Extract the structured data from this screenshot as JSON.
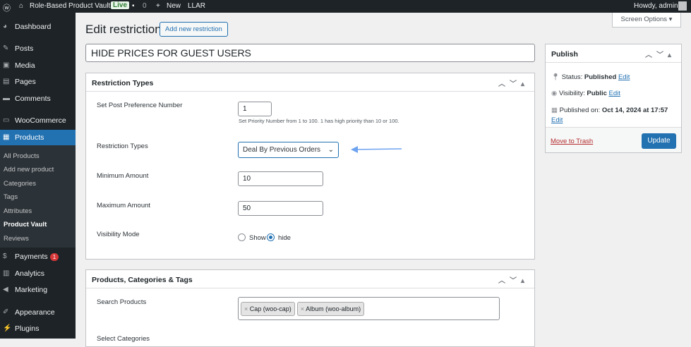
{
  "adminbar": {
    "site": "Role-Based Product Vault",
    "live": "Live",
    "comments": "0",
    "new": "New",
    "llar": "LLAR",
    "howdy": "Howdy, admin"
  },
  "sidebar": {
    "items": [
      "Dashboard",
      "Posts",
      "Media",
      "Pages",
      "Comments",
      "WooCommerce",
      "Products",
      "Payments",
      "Analytics",
      "Marketing",
      "Appearance",
      "Plugins"
    ],
    "payments_badge": "1",
    "sub": [
      "All Products",
      "Add new product",
      "Categories",
      "Tags",
      "Attributes",
      "Product Vault",
      "Reviews"
    ]
  },
  "page": {
    "title": "Edit restriction",
    "add_new": "Add new restriction",
    "screen_options": "Screen Options ▾",
    "post_title": "HIDE PRICES FOR GUEST USERS"
  },
  "restriction": {
    "heading": "Restriction Types",
    "pref_label": "Set Post Preference Number",
    "pref_value": "1",
    "pref_help": "Set Priority Number from 1 to 100. 1 has high priority than 10 or 100.",
    "type_label": "Restriction Types",
    "type_value": "Deal By Previous Orders",
    "min_label": "Minimum Amount",
    "min_value": "10",
    "max_label": "Maximum Amount",
    "max_value": "50",
    "vis_label": "Visibility Mode",
    "show": "Show",
    "hide": "hide"
  },
  "products": {
    "heading": "Products, Categories & Tags",
    "search_label": "Search Products",
    "tags": [
      "Cap (woo-cap)",
      "Album (woo-album)"
    ],
    "cat_label": "Select Categories"
  },
  "publish": {
    "heading": "Publish",
    "status_label": "Status:",
    "status": "Published",
    "visibility_label": "Visibility:",
    "visibility": "Public",
    "published_label": "Published on:",
    "published": "Oct 14, 2024 at 17:57",
    "edit": "Edit",
    "trash": "Move to Trash",
    "update": "Update"
  }
}
